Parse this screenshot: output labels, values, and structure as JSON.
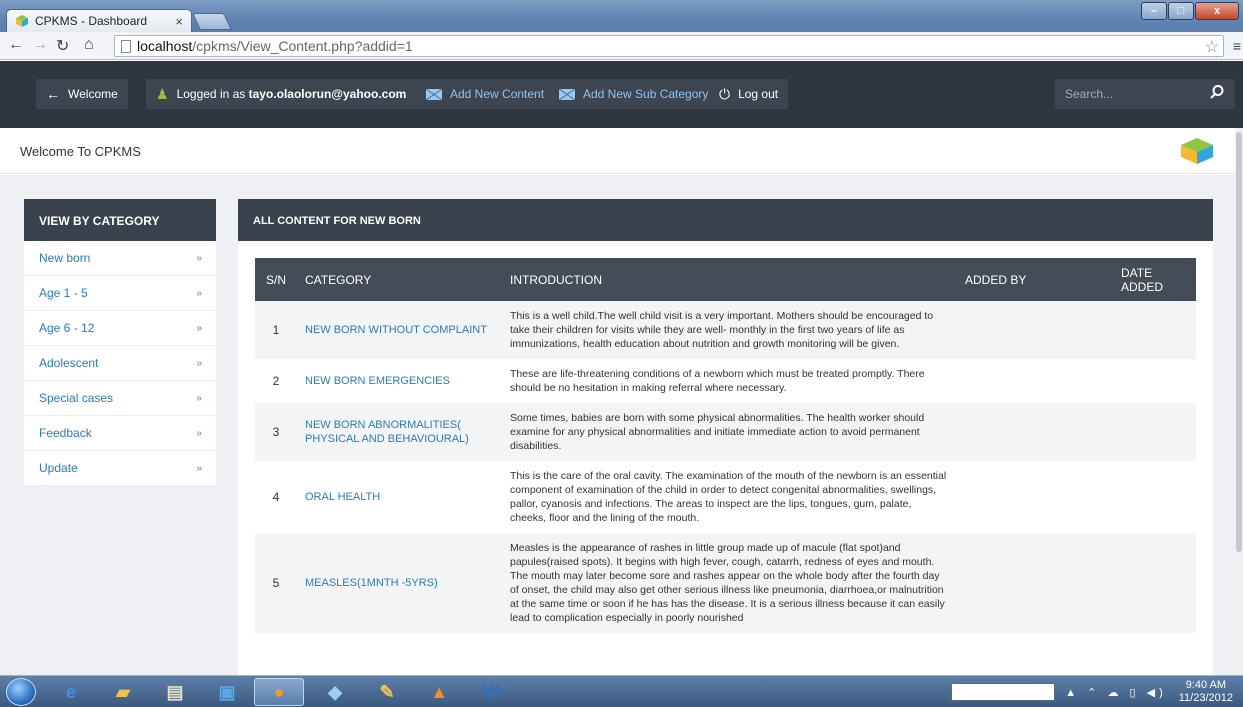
{
  "browser": {
    "tab_title": "CPKMS - Dashboard",
    "tab_close": "×",
    "url_host": "localhost",
    "url_path": "/cpkms/View_Content.php?addid=1"
  },
  "navbar": {
    "welcome_label": "Welcome",
    "logged_in_prefix": "Logged in as ",
    "user_email": "tayo.olaolorun@yahoo.com",
    "add_content_label": "Add New Content",
    "add_subcategory_label": "Add New Sub Category",
    "logout_label": "Log out",
    "search_placeholder": "Search..."
  },
  "header": {
    "welcome_text": "Welcome To CPKMS"
  },
  "sidebar": {
    "title": "VIEW BY CATEGORY",
    "items": [
      {
        "label": "New born"
      },
      {
        "label": "Age 1 - 5"
      },
      {
        "label": "Age 6 - 12"
      },
      {
        "label": "Adolescent"
      },
      {
        "label": "Special cases"
      },
      {
        "label": "Feedback"
      },
      {
        "label": "Update"
      }
    ],
    "arrow": "»"
  },
  "main": {
    "title": "ALL CONTENT FOR NEW BORN",
    "columns": [
      "S/N",
      "CATEGORY",
      "INTRODUCTION",
      "ADDED BY",
      "DATE ADDED"
    ],
    "rows": [
      {
        "sn": "1",
        "category": "NEW BORN WITHOUT COMPLAINT",
        "intro": "This is a well child.The well child visit is a very important. Mothers should be encouraged to take their children for visits while they are well- monthly in the first two years of life as immunizations, health education about nutrition and growth monitoring will be given.",
        "added_by": "",
        "date_added": ""
      },
      {
        "sn": "2",
        "category": "NEW BORN EMERGENCIES",
        "intro": "These are life-threatening conditions of a newborn which must be treated promptly. There should be no hesitation in making referral where necessary.",
        "added_by": "",
        "date_added": ""
      },
      {
        "sn": "3",
        "category": "NEW BORN ABNORMALITIES( PHYSICAL AND BEHAVIOURAL)",
        "intro": "Some times, babies are born with some physical abnormalities. The health worker should examine for any physical abnormalities and initiate immediate action to avoid permanent disabilities.",
        "added_by": "",
        "date_added": ""
      },
      {
        "sn": "4",
        "category": "ORAL HEALTH",
        "intro": "This is the care of the oral cavity. The examination of the mouth of the newborn is an essential component of examination of the child in order to detect congenital abnormalities, swellings, pallor, cyanosis and infections. The areas to inspect are the lips, tongues, gum, palate, cheeks, floor and the lining of the mouth.",
        "added_by": "",
        "date_added": ""
      },
      {
        "sn": "5",
        "category": "MEASLES(1MNTH -5YRS)",
        "intro": "Measles is the appearance of rashes in little group made up of macule (flat spot)and papules(raised spots). It begins with high fever, cough, catarrh, redness of eyes and mouth. The mouth may later become sore and rashes appear on the whole body after the fourth day of onset, the child may also get other serious illness like pneumonia, diarrhoea,or malnutrition at the same time or soon if he has has the disease. It is a serious illness because it can easily lead to complication especially in poorly nourished",
        "added_by": "",
        "date_added": ""
      }
    ]
  },
  "taskbar": {
    "time": "9:40 AM",
    "date": "11/23/2012"
  }
}
